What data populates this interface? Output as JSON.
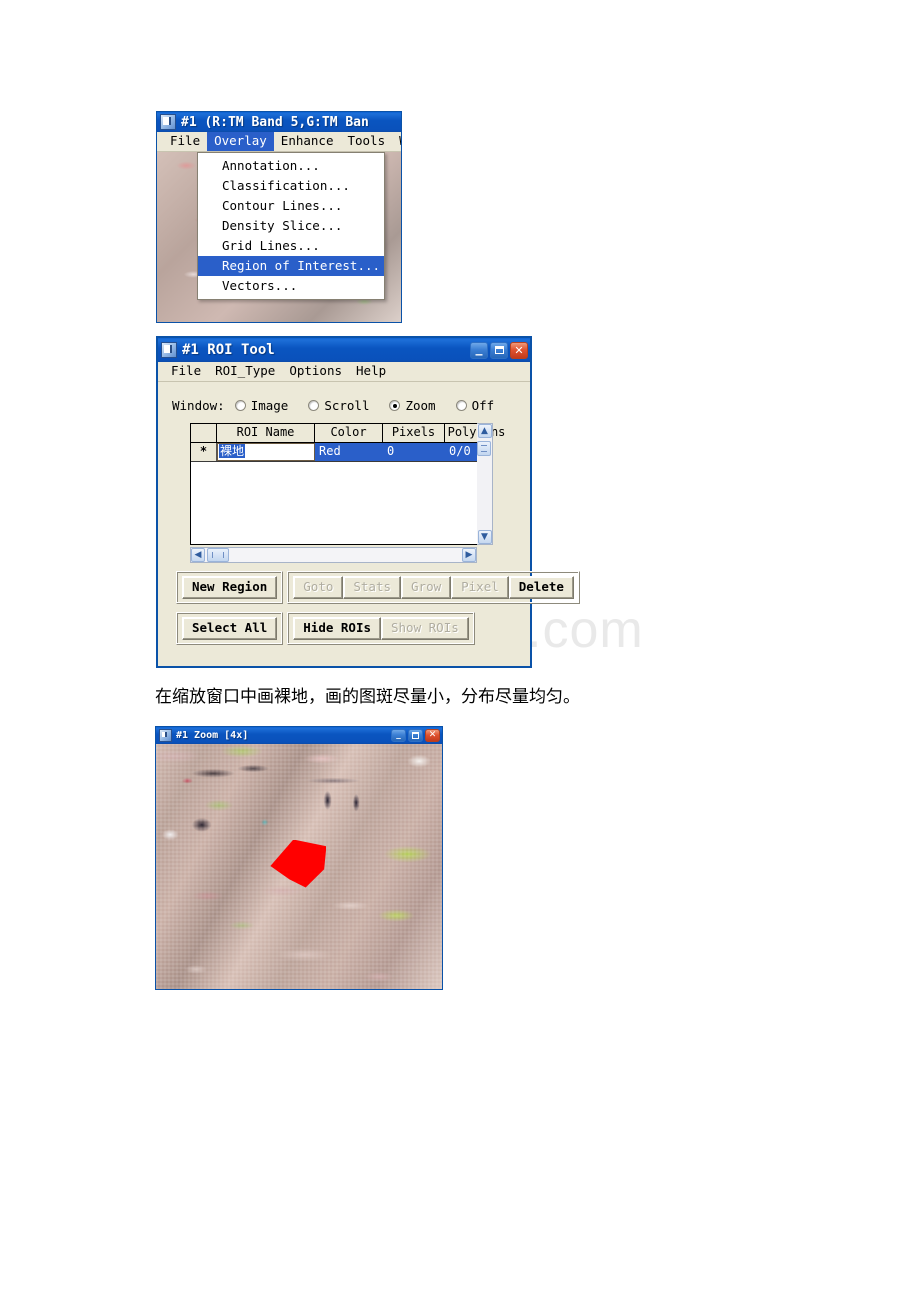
{
  "watermark": {
    "text": "www.bdocx.com"
  },
  "image_window": {
    "title": "#1 (R:TM Band 5,G:TM Ban",
    "icon": "envi-window-icon",
    "menubar": [
      {
        "label": "File",
        "active": false
      },
      {
        "label": "Overlay",
        "active": true
      },
      {
        "label": "Enhance",
        "active": false
      },
      {
        "label": "Tools",
        "active": false
      },
      {
        "label": "Win",
        "active": false
      }
    ],
    "dropdown": {
      "items": [
        {
          "label": "Annotation...",
          "selected": false
        },
        {
          "label": "Classification...",
          "selected": false
        },
        {
          "label": "Contour Lines...",
          "selected": false
        },
        {
          "label": "Density Slice...",
          "selected": false
        },
        {
          "label": "Grid Lines...",
          "selected": false
        },
        {
          "label": "Region of Interest...",
          "selected": true
        },
        {
          "label": "Vectors...",
          "selected": false
        }
      ]
    }
  },
  "roi_window": {
    "title": "#1 ROI Tool",
    "icon": "envi-window-icon",
    "titlebar_buttons": {
      "minimize": "_",
      "maximize": "maximize-icon",
      "close": "✕"
    },
    "menubar": [
      {
        "label": "File"
      },
      {
        "label": "ROI_Type"
      },
      {
        "label": "Options"
      },
      {
        "label": "Help"
      }
    ],
    "window_row": {
      "label": "Window:",
      "options": [
        {
          "label": "Image",
          "checked": false
        },
        {
          "label": "Scroll",
          "checked": false
        },
        {
          "label": "Zoom",
          "checked": true
        },
        {
          "label": "Off",
          "checked": false
        }
      ]
    },
    "table": {
      "columns": [
        "ROI Name",
        "Color",
        "Pixels",
        "Polygons"
      ],
      "rows": [
        {
          "marker": "*",
          "name": "裸地",
          "name_editing": true,
          "color": "Red",
          "pixels": "0",
          "polygons": "0/0",
          "selected": true
        }
      ]
    },
    "buttons_row1": [
      {
        "label": "New Region",
        "enabled": true
      },
      {
        "label": "Goto",
        "enabled": false
      },
      {
        "label": "Stats",
        "enabled": false
      },
      {
        "label": "Grow",
        "enabled": false
      },
      {
        "label": "Pixel",
        "enabled": false
      },
      {
        "label": "Delete",
        "enabled": true
      }
    ],
    "buttons_row2": [
      {
        "label": "Select All",
        "enabled": true
      },
      {
        "label": "Hide ROIs",
        "enabled": true
      },
      {
        "label": "Show ROIs",
        "enabled": false
      }
    ]
  },
  "caption": {
    "text": "在缩放窗口中画裸地，画的图斑尽量小，分布尽量均匀。"
  },
  "zoom_window": {
    "title": "#1 Zoom [4x]",
    "icon": "envi-window-icon",
    "titlebar_buttons": {
      "minimize": "_",
      "maximize": "maximize-icon",
      "close": "✕"
    },
    "roi_polygon_color": "#ff0000"
  },
  "colors": {
    "titlebar_blue": "#0a52a8",
    "selection_blue": "#2a5fc9",
    "window_face": "#ece9d8",
    "roi_red": "#ff0000"
  }
}
